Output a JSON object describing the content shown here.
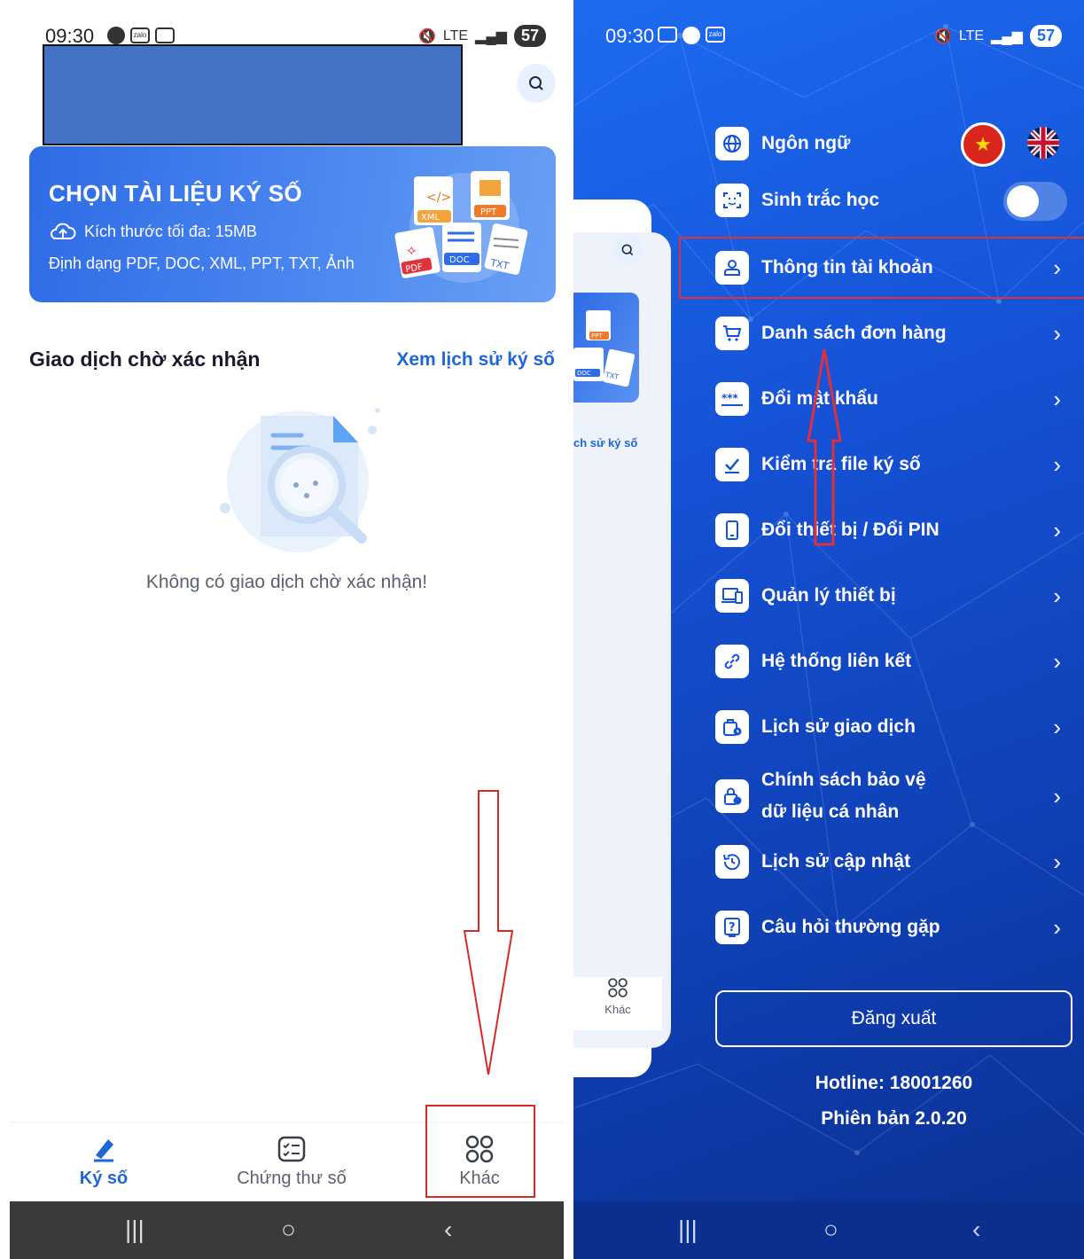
{
  "status_bar": {
    "time": "09:30",
    "battery": "57",
    "network": "LTE"
  },
  "left": {
    "upload_card": {
      "title": "CHỌN TÀI LIỆU KÝ SỐ",
      "max_size": "Kích thước tối đa: 15MB",
      "formats": "Định dạng PDF, DOC, XML, PPT, TXT, Ảnh",
      "file_badges": [
        "XML",
        "PPT",
        "PDF",
        "DOC",
        "TXT"
      ]
    },
    "pending": {
      "title": "Giao dịch chờ xác nhận",
      "history_link": "Xem lịch sử ký số",
      "empty_text": "Không có giao dịch chờ xác nhận!"
    },
    "bottom_nav": [
      {
        "label": "Ký số",
        "icon": "pen-icon",
        "active": true
      },
      {
        "label": "Chứng thư số",
        "icon": "certificate-icon",
        "active": false
      },
      {
        "label": "Khác",
        "icon": "grid-icon",
        "active": false
      }
    ]
  },
  "right": {
    "behind_panel": {
      "history_link": "ch sử ký số",
      "khac_label": "Khác",
      "file_badges": [
        "PPT",
        "DOC",
        "TXT"
      ]
    },
    "menu": [
      {
        "label": "Ngôn ngữ",
        "icon": "globe-icon"
      },
      {
        "label": "Sinh trắc học",
        "icon": "face-id-icon"
      },
      {
        "label": "Thông tin tài khoản",
        "icon": "user-icon"
      },
      {
        "label": "Danh sách đơn hàng",
        "icon": "cart-icon"
      },
      {
        "label": "Đổi mật khẩu",
        "icon": "password-icon"
      },
      {
        "label": "Kiểm tra file ký số",
        "icon": "check-file-icon"
      },
      {
        "label": "Đổi thiết bị / Đổi PIN",
        "icon": "phone-icon"
      },
      {
        "label": "Quản lý thiết bị",
        "icon": "devices-icon"
      },
      {
        "label": "Hệ thống liên kết",
        "icon": "link-icon"
      },
      {
        "label": "Lịch sử giao dịch",
        "icon": "history-bag-icon"
      },
      {
        "label": "Chính sách bảo vệ dữ liệu cá nhân",
        "label_line1": "Chính sách bảo vệ",
        "label_line2": "dữ liệu cá nhân",
        "icon": "privacy-lock-icon"
      },
      {
        "label": "Lịch sử cập nhật",
        "icon": "update-history-icon"
      },
      {
        "label": "Câu hỏi thường gặp",
        "icon": "faq-icon"
      }
    ],
    "biometric_enabled": false,
    "logout_label": "Đăng xuất",
    "hotline": "Hotline: 18001260",
    "version": "Phiên bản 2.0.20"
  },
  "colors": {
    "primary": "#1f66d6",
    "annotation_red": "#d62a2a",
    "menu_bg": "#1552d6"
  }
}
